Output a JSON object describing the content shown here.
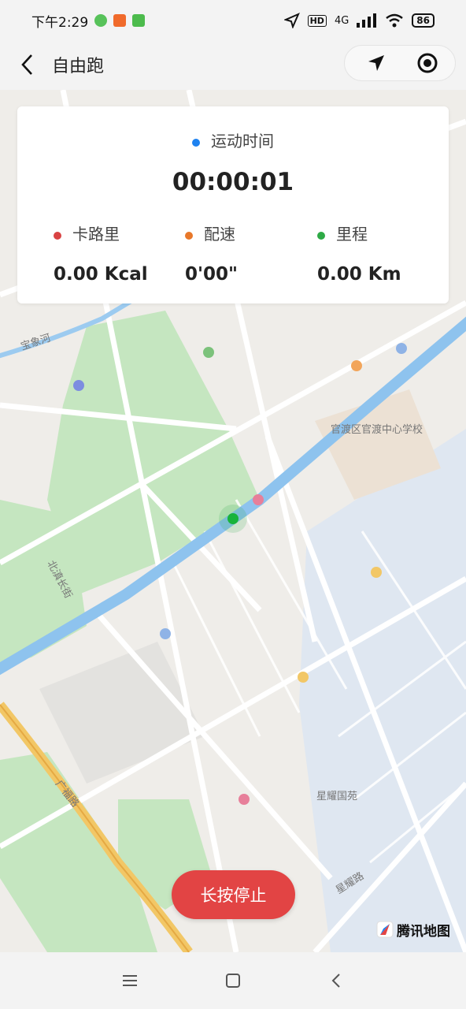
{
  "status_bar": {
    "time": "下午2:29",
    "network": "4G",
    "battery": "86"
  },
  "header": {
    "title": "自由跑"
  },
  "stats": {
    "time_label": "运动时间",
    "time_value": "00:00:01",
    "calories": {
      "label": "卡路里",
      "value": "0.00 Kcal"
    },
    "pace": {
      "label": "配速",
      "value": "0'00\""
    },
    "distance": {
      "label": "里程",
      "value": "0.00 Km"
    }
  },
  "colors": {
    "time_dot": "#1e82f0",
    "calories_dot": "#d94343",
    "pace_dot": "#e8782a",
    "distance_dot": "#2eaa46",
    "stop_button": "#e24444"
  },
  "map": {
    "labels": {
      "river": "宝象河",
      "road_a": "北滇长街",
      "road_b": "星耀路",
      "road_c": "广福路",
      "poi_school": "官渡区官渡中心学校",
      "poi_garden": "星耀国苑"
    },
    "provider": "腾讯地图"
  },
  "stop_button": {
    "label": "长按停止"
  }
}
